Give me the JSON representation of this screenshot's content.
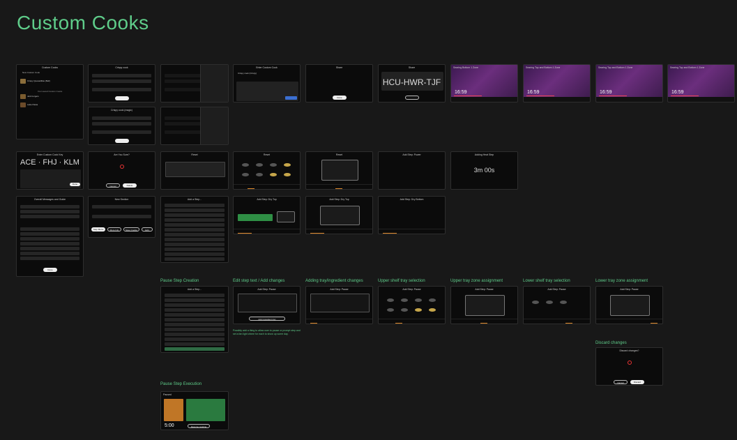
{
  "page": {
    "title": "Custom Cooks"
  },
  "frames": {
    "custom_cooks": {
      "title": "Custom Cooks",
      "new": "New Custom Cook",
      "item1": "Crispy Quesadillas (Bell)",
      "section": "Your saved Custom Cooks",
      "item2": "Jerk burgers",
      "item3": "Latte Pasta"
    },
    "recipe1": {
      "title": "Crispy cook"
    },
    "recipe2": {
      "title": "Crispy cook (magic)"
    },
    "enter_code": {
      "title": "Enter Custom Cook",
      "field": "Crispy cook (Crispy)"
    },
    "share1": {
      "title": "Share",
      "btn": "Done"
    },
    "share2": {
      "title": "Share",
      "code": "HCU-HWR-TJF"
    },
    "video1": {
      "title": "Searing Bottom 1 Zone",
      "time": "16:59"
    },
    "video2": {
      "title": "Searing Top and Bottom 1 Zone",
      "time": "16:59"
    },
    "video3": {
      "title": "Searing Top and Bottom 1 Zone",
      "time": "16:59"
    },
    "video4": {
      "title": "Searing Top and Bottom 1 Zone",
      "time": "16:59"
    },
    "enter_code2": {
      "title": "Enter Custom Cook Key",
      "code": "ACE · FHJ · KLM",
      "go": "Done"
    },
    "are_you_sure": {
      "title": "Are You Sure?",
      "cancel": "Cancel",
      "delete": "Delete"
    },
    "reset": {
      "title": "Reset"
    },
    "reset2": {
      "title": "Reset"
    },
    "reset3": {
      "title": "Reset"
    },
    "add_step_power": {
      "title": "Add Step: Power"
    },
    "adding_heat": {
      "title": "Adding Heat Step",
      "timer": "3m 00s"
    },
    "overall_steps": {
      "title": "Overall Messages and Guide",
      "btn": "Done"
    },
    "new_section": {
      "title": "New Section",
      "b1": "Step Menu",
      "b2": "More Info",
      "b3": "Save Cookie",
      "b4": "Edit"
    },
    "add_step_list": {
      "title": "Add a Step..."
    },
    "add_step_dry": {
      "title": "Add Step: Dry Top"
    },
    "add_step_dry2": {
      "title": "Add Step: Dry Top"
    },
    "add_step_dry3": {
      "title": "Add Step: Dry Bottom"
    },
    "pause_list": {
      "title": "Add a Step..."
    },
    "edit_text": {
      "title": "Add Step: Pause",
      "btn": "Add ingredient tray",
      "note": "Possibly add a thing to allow user to pause or prompt step and set a fan light chime for each to show up some day."
    },
    "adding_tray": {
      "title": "Add Step: Pause"
    },
    "upper_select": {
      "title": "Add Step: Pause"
    },
    "upper_zone": {
      "title": "Add Step: Pause"
    },
    "lower_select": {
      "title": "Add Step: Pause"
    },
    "lower_zone": {
      "title": "Add Step: Pause"
    },
    "discard": {
      "title": "Discard changes?",
      "cancel": "Cancel",
      "discard": "Discard"
    },
    "paused": {
      "title": "Paused",
      "time": "5:00",
      "btn": "Resume cooking"
    }
  },
  "sections": {
    "pause_creation": "Pause Step Creation",
    "edit_text": "Edit step text / Add changes",
    "adding_tray": "Adding tray/ingredient changes",
    "upper_select": "Upper shelf tray selection",
    "upper_zone": "Upper tray zone assignment",
    "lower_select": "Lower shelf tray selection",
    "lower_zone": "Lower tray zone assignment",
    "discard": "Discard changes",
    "pause_execution": "Pause Step Execution"
  }
}
